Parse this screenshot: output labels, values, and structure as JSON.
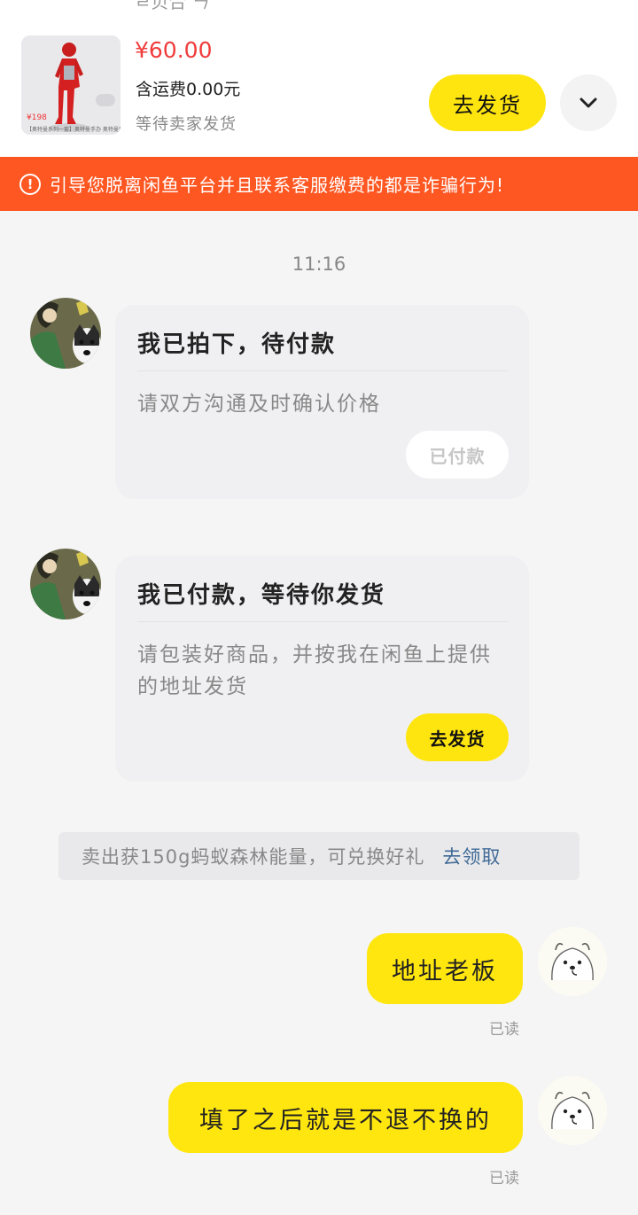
{
  "product": {
    "top_cut_text": "ㄹ贝合 ㄣ",
    "thumb_price": "¥198",
    "thumb_caption": "【奥特曼系列一套】奥特曼手办 奥特曼玩具 正品",
    "price": "¥60.00",
    "shipping": "含运费0.00元",
    "status": "等待卖家发货",
    "ship_button": "去发货",
    "expand_icon": "chevron-down-icon"
  },
  "warning": {
    "icon": "exclamation-circle-icon",
    "text": "引导您脱离闲鱼平台并且联系客服缴费的都是诈骗行为!"
  },
  "chat": {
    "timestamp": "11:16",
    "cards": [
      {
        "title": "我已拍下，待付款",
        "desc": "请双方沟通及时确认价格",
        "button": "已付款"
      },
      {
        "title": "我已付款，等待你发货",
        "desc": "请包装好商品，并按我在闲鱼上提供的地址发货",
        "button": "去发货"
      }
    ],
    "energy_banner": {
      "text": "卖出获150g蚂蚁森林能量，可兑换好礼",
      "link": "去领取"
    },
    "messages": [
      {
        "text": "地址老板",
        "read": "已读"
      },
      {
        "text": "填了之后就是不退不换的",
        "read": "已读"
      }
    ]
  },
  "colors": {
    "accent_yellow": "#ffe50f",
    "warning_orange": "#ff5722",
    "price_red": "#f03b3b",
    "link_blue": "#3f6a96"
  }
}
